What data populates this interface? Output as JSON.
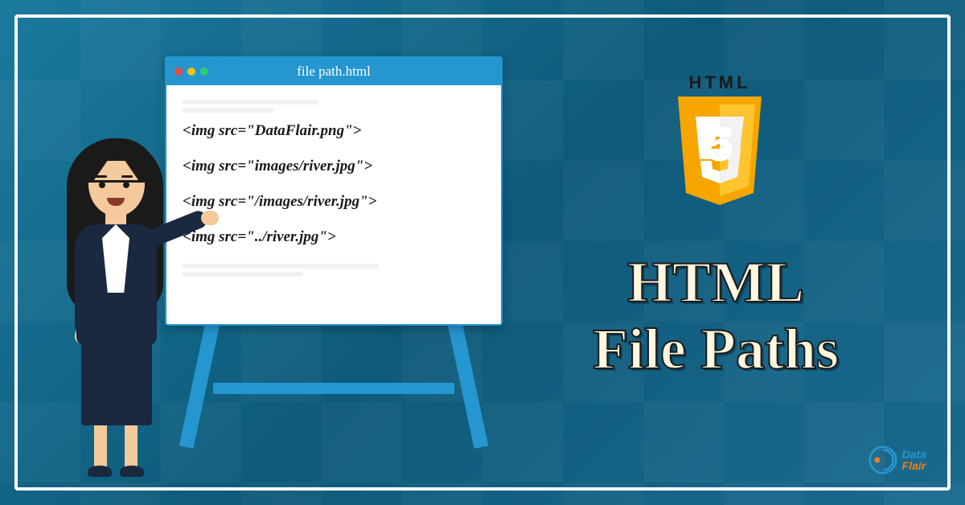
{
  "window": {
    "title": "file path.html"
  },
  "code": {
    "lines": [
      "<img src=\"DataFlair.png\">",
      "<img src=\"images/river.jpg\">",
      "<img src=\"/images/river.jpg\">",
      "<img src=\"../river.jpg\">"
    ]
  },
  "html5": {
    "label": "HTML",
    "number": "5"
  },
  "title": {
    "line1": "HTML",
    "line2": "File Paths"
  },
  "brand": {
    "data": "Data",
    "flair": "Flair"
  }
}
